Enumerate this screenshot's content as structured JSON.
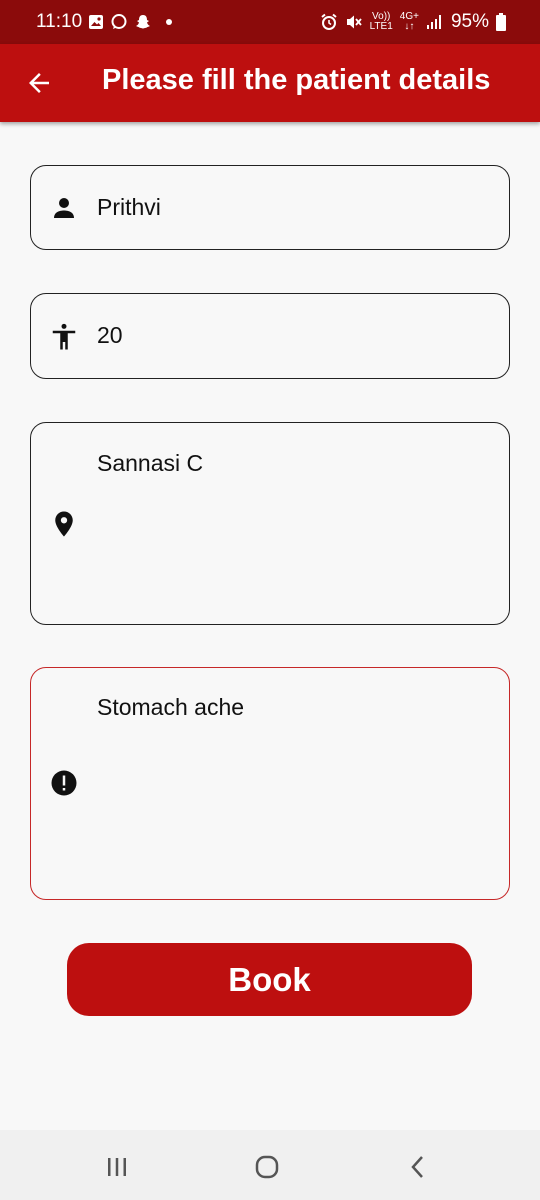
{
  "status_bar": {
    "time": "11:10",
    "volte_top": "Vo))",
    "volte_bottom": "LTE1",
    "network": "4G+",
    "battery": "95%"
  },
  "app_bar": {
    "title": "Please fill the patient details"
  },
  "form": {
    "name_value": "Prithvi",
    "age_value": "20",
    "address_value": "Sannasi C",
    "problem_value": "Stomach ache"
  },
  "actions": {
    "book_label": "Book"
  },
  "icons": {
    "back": "arrow-back-icon",
    "name": "person-icon",
    "age": "accessibility-icon",
    "address": "location-pin-icon",
    "problem": "error-icon"
  },
  "colors": {
    "primary": "#bd0f0f",
    "status_bar": "#8b0b0b",
    "error_border": "#c62828"
  }
}
